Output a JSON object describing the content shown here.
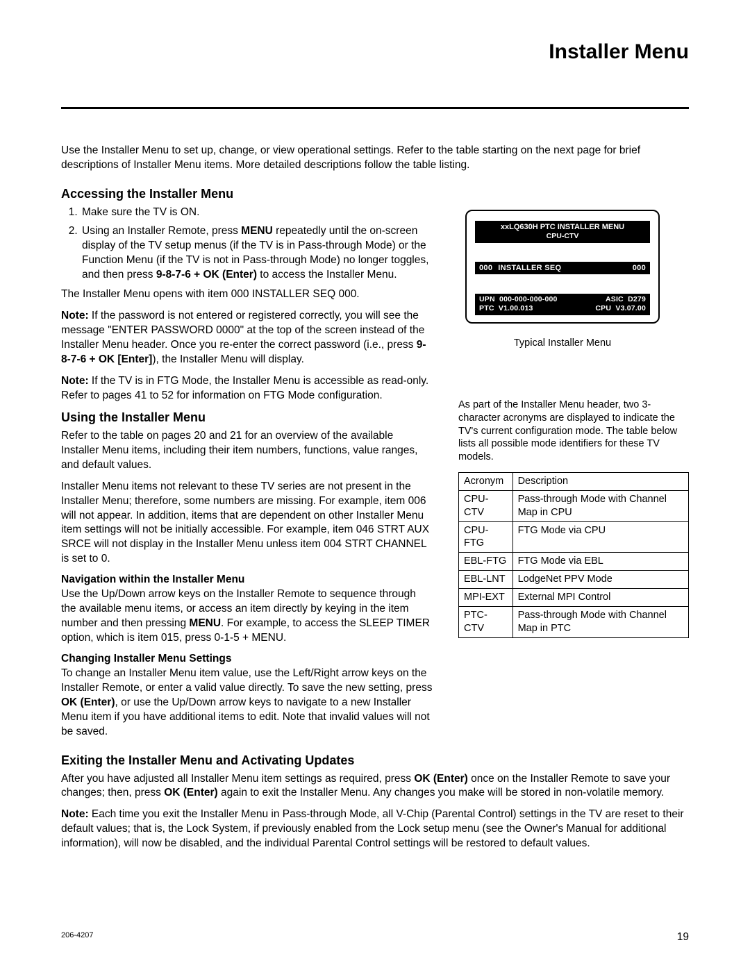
{
  "page_title": "Installer Menu",
  "intro": "Use the Installer Menu to set up, change, or view operational settings. Refer to the table starting on the next page for brief descriptions of Installer Menu items. More detailed descriptions follow the table listing.",
  "section_access": {
    "heading": "Accessing the Installer Menu",
    "step1": "Make sure the TV is ON.",
    "step2_a": "Using an Installer Remote, press ",
    "step2_menu": "MENU",
    "step2_b": " repeatedly until the on-screen display of the TV setup menus (if the TV is in Pass-through Mode) or the Function Menu (if the TV is not in Pass-through Mode) no longer toggles, and then press ",
    "step2_seq": "9-8-7-6 + OK (Enter)",
    "step2_c": " to access the Installer Menu.",
    "opens": "The Installer Menu opens with item 000 INSTALLER SEQ 000.",
    "note1_label": "Note:",
    "note1_a": " If the password is not entered or registered correctly, you will see the message \"ENTER PASSWORD 0000\" at the top of the screen instead of the Installer Menu header. Once you re-enter the correct password (i.e., press ",
    "note1_seq": "9-8-7-6 + OK [Enter]",
    "note1_b": "), the Installer Menu will display.",
    "note2_label": "Note:",
    "note2": " If the TV is in FTG Mode, the Installer Menu is accessible as read-only. Refer to pages 41 to 52 for information on FTG Mode configuration."
  },
  "section_using": {
    "heading": "Using the Installer Menu",
    "p1": "Refer to the table on pages 20 and 21 for an overview of the available Installer Menu items, including their item numbers, functions, value ranges, and default values.",
    "p2": "Installer Menu items not relevant to these TV series are not present in the Installer Menu; therefore, some numbers are missing. For example, item 006 will not appear. In addition, items that are dependent on other Installer Menu item settings will not be initially accessible. For example, item 046 STRT AUX SRCE will not display in the Installer Menu unless item 004 STRT CHANNEL is set to 0.",
    "nav_heading": "Navigation within the Installer Menu",
    "nav_a": "Use the Up/Down arrow keys on the Installer Remote to sequence through the available menu items, or access an item directly by keying in the item number and then pressing ",
    "nav_menu": "MENU",
    "nav_b": ". For example, to access the SLEEP TIMER option, which is item 015, press 0-1-5 + MENU.",
    "change_heading": "Changing Installer Menu Settings",
    "change_a": "To change an Installer Menu item value, use the Left/Right arrow keys on the Installer Remote, or enter a valid value directly. To save the new setting, press ",
    "change_ok": "OK (Enter)",
    "change_b": ", or use the Up/Down arrow keys to navigate to a new Installer Menu item if you have additional items to edit. Note that invalid values will not be saved."
  },
  "section_exit": {
    "heading": "Exiting the Installer Menu and Activating Updates",
    "p1_a": "After you have adjusted all Installer Menu item settings as required, press ",
    "p1_ok1": "OK (Enter)",
    "p1_b": " once on the Installer Remote to save your changes; then, press ",
    "p1_ok2": "OK (Enter)",
    "p1_c": " again to exit the Installer Menu. Any changes you make will be stored in non-volatile memory.",
    "note_label": "Note:",
    "note": " Each time you exit the Installer Menu in Pass-through Mode, all V-Chip (Parental Control) settings in the TV are reset to their default values; that is, the Lock System, if previously enabled from the Lock setup menu (see the Owner's Manual for additional information), will now be disabled, and the individual Parental Control settings will be restored to default values."
  },
  "menu_box": {
    "header_line1": "xxLQ630H  PTC  INSTALLER  MENU",
    "header_line2": "CPU-CTV",
    "item_num": "000",
    "item_label": "INSTALLER SEQ",
    "item_val": "000",
    "upn_label": "UPN",
    "upn_val": "000-000-000-000",
    "asic_label": "ASIC",
    "asic_val": "D279",
    "ptc_label": "PTC",
    "ptc_val": "V1.00.013",
    "cpu_label": "CPU",
    "cpu_val": "V3.07.00",
    "caption": "Typical Installer Menu"
  },
  "table_intro": "As part of the Installer Menu header, two 3-character acronyms are displayed to indicate the TV's current configuration mode. The table below lists all possible mode identifiers for these TV models.",
  "table": {
    "h1": "Acronym",
    "h2": "Description",
    "rows": [
      {
        "a": "CPU-CTV",
        "d": "Pass-through Mode with Channel Map in CPU"
      },
      {
        "a": "CPU-FTG",
        "d": "FTG Mode via CPU"
      },
      {
        "a": "EBL-FTG",
        "d": "FTG Mode via EBL"
      },
      {
        "a": "EBL-LNT",
        "d": "LodgeNet PPV Mode"
      },
      {
        "a": "MPI-EXT",
        "d": "External MPI Control"
      },
      {
        "a": "PTC-CTV",
        "d": "Pass-through Mode with Channel Map in PTC"
      }
    ]
  },
  "footer_left": "206-4207",
  "footer_right": "19"
}
